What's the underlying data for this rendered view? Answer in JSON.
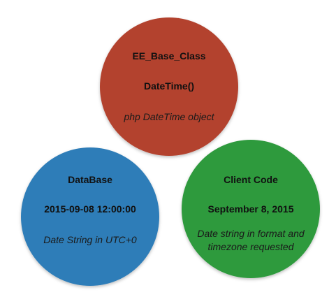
{
  "nodes": [
    {
      "title": "EE_Base_Class",
      "value": "DateTime()",
      "desc": [
        "php DateTime object"
      ],
      "color": "#b3432f"
    },
    {
      "title": "DataBase",
      "value": "2015-09-08 12:00:00",
      "desc": [
        "Date String in UTC+0"
      ],
      "color": "#2f7db8"
    },
    {
      "title": "Client Code",
      "value": "September 8, 2015",
      "desc": [
        "Date string in format and",
        "timezone requested"
      ],
      "color": "#2e9a3e"
    }
  ]
}
